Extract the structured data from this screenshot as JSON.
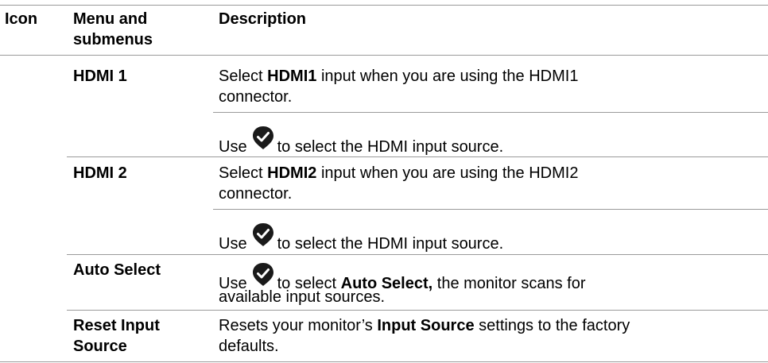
{
  "header": {
    "icon": "Icon",
    "menu": "Menu and submenus",
    "menu_line1": "Menu and",
    "menu_line2": "submenus",
    "description": "Description"
  },
  "rows": [
    {
      "menu": "HDMI 1",
      "desc_line1_pre": "Select ",
      "desc_line1_bold": "HDMI1",
      "desc_line1_post": " input when you are using the HDMI1",
      "desc_line2": "connector.",
      "use_pre": "Use",
      "use_post": "to select the HDMI input source."
    },
    {
      "menu": "HDMI 2",
      "desc_line1_pre": "Select ",
      "desc_line1_bold": "HDMI2",
      "desc_line1_post": " input when you are using the HDMI2",
      "desc_line2": "connector.",
      "use_pre": "Use",
      "use_post": "to select the HDMI input source."
    },
    {
      "menu": "Auto Select",
      "use_pre": "Use",
      "use_mid": "to select ",
      "use_bold": "Auto Select,",
      "use_post": " the monitor scans for",
      "desc_line2": "available input sources."
    },
    {
      "menu_line1": "Reset Input",
      "menu_line2": "Source",
      "desc_line1_pre": "Resets your monitor’s ",
      "desc_line1_bold": "Input Source",
      "desc_line1_post": " settings to the factory",
      "desc_line2": "defaults."
    }
  ],
  "icons": {
    "confirm": "checkmark-icon",
    "confirm_color": "#1a1a1a"
  }
}
